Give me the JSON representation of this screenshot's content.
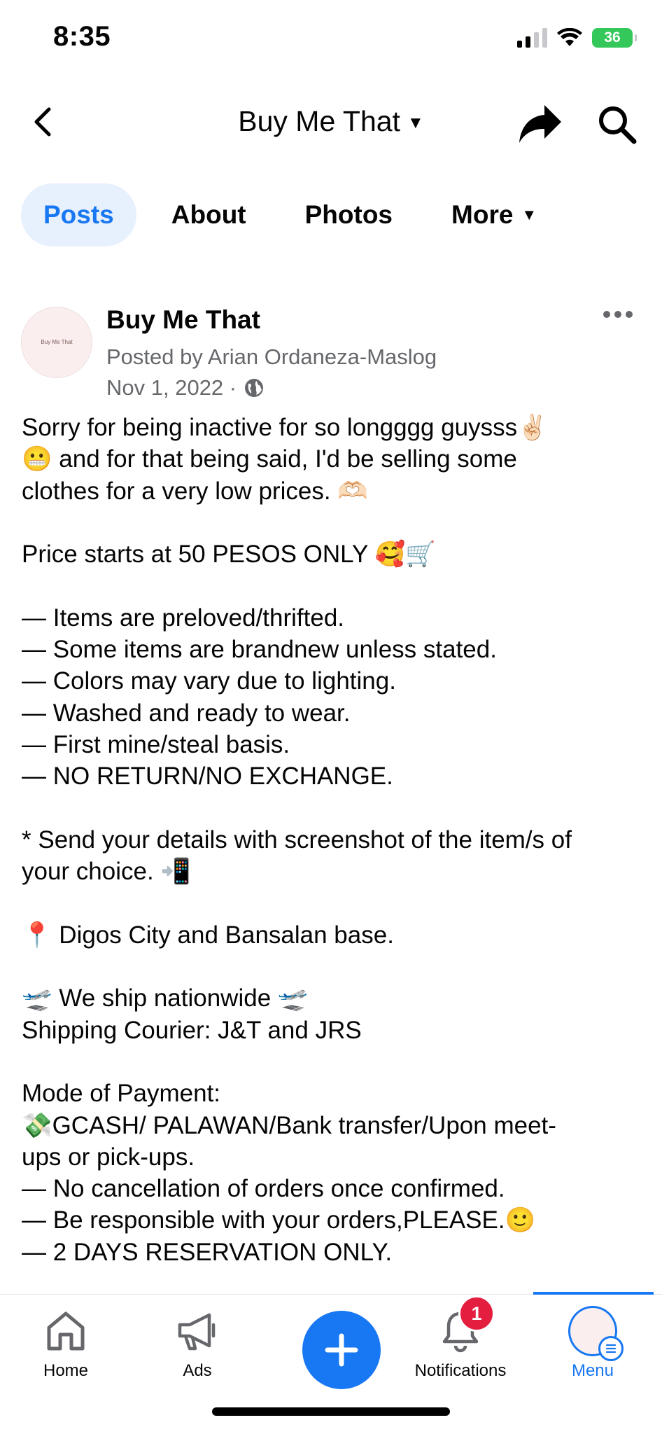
{
  "status_bar": {
    "time": "8:35",
    "battery": "36"
  },
  "header": {
    "title": "Buy Me That"
  },
  "tabs": [
    {
      "label": "Posts",
      "active": true
    },
    {
      "label": "About",
      "active": false
    },
    {
      "label": "Photos",
      "active": false
    },
    {
      "label": "More",
      "active": false
    }
  ],
  "post": {
    "page_name": "Buy Me That",
    "posted_by": "Posted by Arian Ordaneza-Maslog",
    "date": "Nov 1, 2022 ·",
    "avatar_text": "Buy Me That",
    "lines": [
      "Sorry for being inactive for so longggg guysss✌🏻",
      "😬 and for that being said, I'd be selling some",
      "clothes for a very low prices. 🫶🏻",
      "",
      "Price starts at 50 PESOS ONLY 🥰🛒",
      "",
      "— Items are preloved/thrifted.",
      "— Some items are brandnew unless stated.",
      "— Colors may vary due to lighting.",
      "— Washed and ready to wear.",
      "— First mine/steal basis.",
      "— NO RETURN/NO EXCHANGE.",
      "",
      "* Send your details with screenshot of the item/s of",
      "your choice. 📲",
      "",
      "📍 Digos City and Bansalan base.",
      "",
      "🛫 We ship nationwide 🛫",
      "Shipping Courier: J&T and JRS",
      "",
      "Mode of Payment:",
      "💸GCASH/ PALAWAN/Bank transfer/Upon meet-",
      "ups or pick-ups.",
      "— No cancellation of orders once confirmed.",
      "— Be responsible with your orders,PLEASE.🙂",
      "— 2 DAYS RESERVATION ONLY."
    ]
  },
  "bottom_nav": {
    "home": "Home",
    "ads": "Ads",
    "notifications": "Notifications",
    "notifications_badge": "1",
    "menu": "Menu"
  },
  "colors": {
    "accent": "#1877f2",
    "active_tab_bg": "#e7f0fd",
    "badge": "#e41e3f",
    "secondary_text": "#65676b"
  }
}
